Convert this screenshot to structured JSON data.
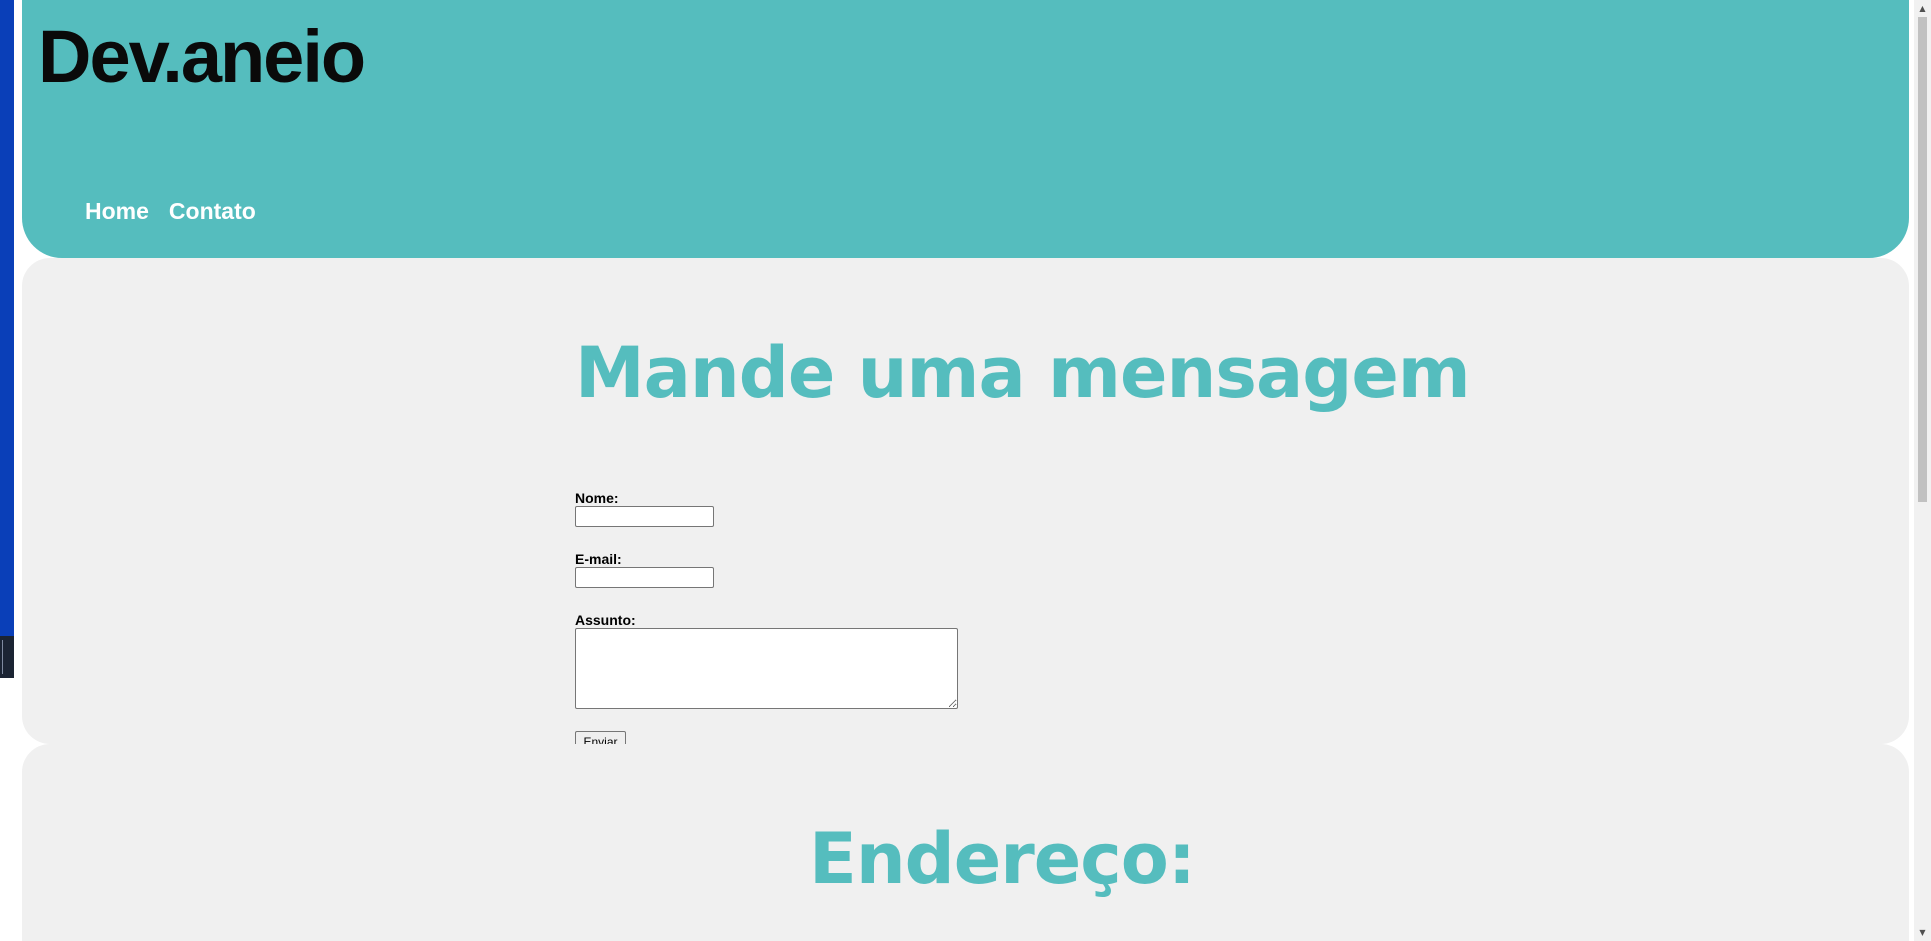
{
  "header": {
    "logo": "Dev.aneio",
    "nav": [
      {
        "label": "Home"
      },
      {
        "label": "Contato"
      }
    ]
  },
  "message_section": {
    "heading": "Mande uma mensagem",
    "form": {
      "name_label": "Nome:",
      "name_value": "",
      "email_label": "E-mail:",
      "email_value": "",
      "subject_label": "Assunto:",
      "subject_value": "",
      "submit_label": "Enviar"
    }
  },
  "address_section": {
    "heading": "Endereço:"
  },
  "colors": {
    "accent": "#55bdbe",
    "section_bg": "#f0f0f0",
    "logo": "#0a0a0a"
  },
  "scrollbar": {
    "up_icon": "triangle-up-icon",
    "down_icon": "triangle-down-icon"
  }
}
